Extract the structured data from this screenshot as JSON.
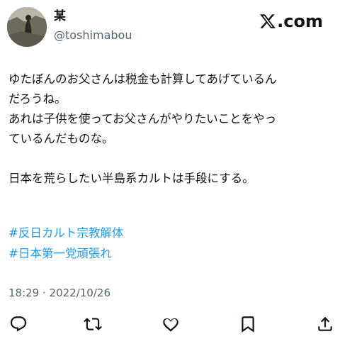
{
  "author": {
    "display_name": "某",
    "handle": "@toshimabou",
    "avatar_icon": "profile-photo"
  },
  "brand": {
    "icon": "x-logo-icon",
    "text": ".com"
  },
  "tweet": {
    "lines": [
      "ゆたぼんのお父さんは税金も計算してあげているん",
      "だろうね。",
      "あれは子供を使ってお父さんがやりたいことをやっ",
      "ているんだものな。",
      "日本を荒らしたい半島系カルトは手段にする。"
    ],
    "hashtags": [
      "#反日カルト宗教解体",
      "#日本第一党頑張れ"
    ],
    "timestamp": "18:29 · 2022/10/26"
  },
  "actions": [
    {
      "name": "reply-icon"
    },
    {
      "name": "retweet-icon"
    },
    {
      "name": "like-icon"
    },
    {
      "name": "bookmark-icon"
    },
    {
      "name": "share-icon"
    }
  ],
  "colors": {
    "text": "#0f1419",
    "secondary": "#536471",
    "link": "#1d9bf0"
  }
}
